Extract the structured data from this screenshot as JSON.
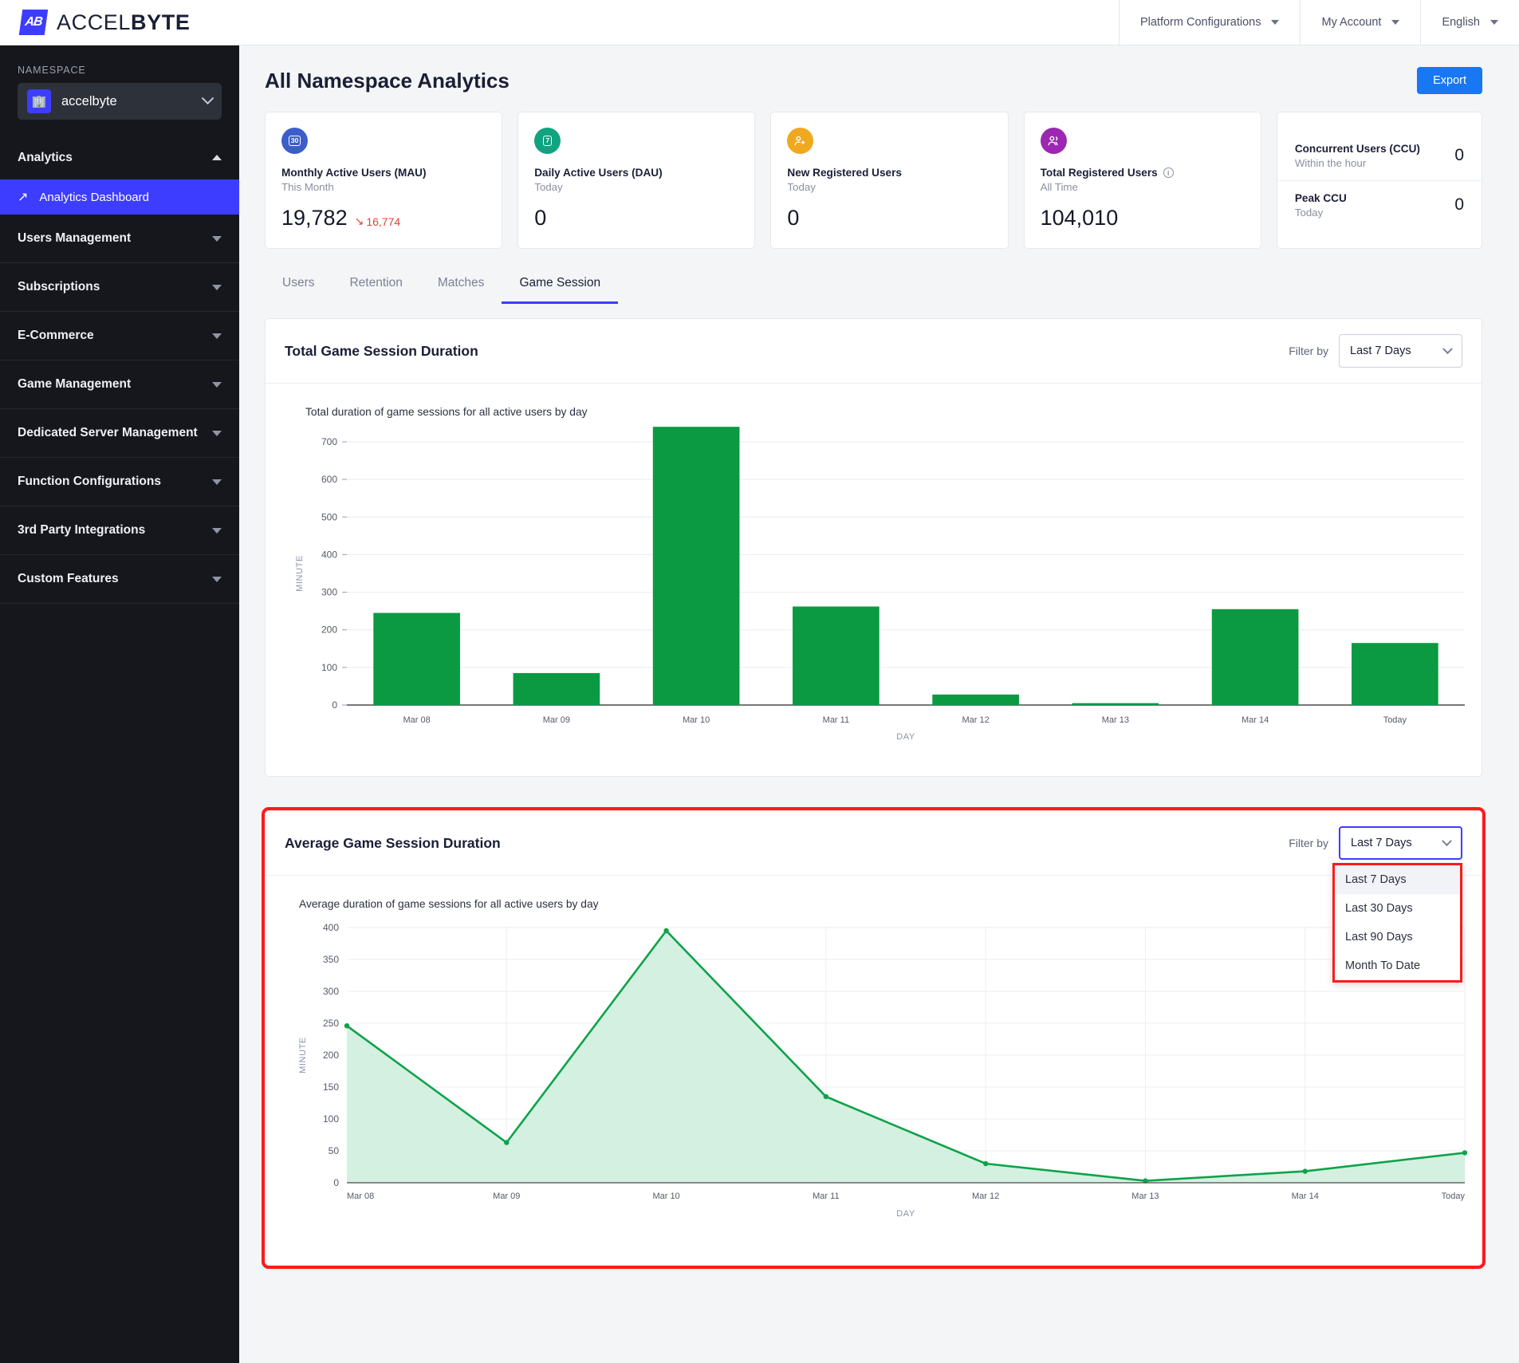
{
  "brand": {
    "name_light": "ACCEL",
    "name_bold": "BYTE",
    "mark_glyph": "AB"
  },
  "topnav": {
    "items": [
      {
        "label": "Platform Configurations",
        "icon": "chevron-down-icon"
      },
      {
        "label": "My Account",
        "icon": "chevron-down-icon"
      },
      {
        "label": "English",
        "icon": "chevron-down-icon"
      }
    ]
  },
  "sidebar": {
    "namespace_label": "NAMESPACE",
    "namespace_value": "accelbyte",
    "namespace_icon": "building-icon",
    "analytics_group": "Analytics",
    "analytics_sub": {
      "label": "Analytics Dashboard",
      "icon": "trending-up-icon"
    },
    "groups": [
      {
        "label": "Users Management"
      },
      {
        "label": "Subscriptions"
      },
      {
        "label": "E-Commerce"
      },
      {
        "label": "Game Management"
      },
      {
        "label": "Dedicated Server Management"
      },
      {
        "label": "Function Configurations"
      },
      {
        "label": "3rd Party Integrations"
      },
      {
        "label": "Custom Features"
      }
    ]
  },
  "header": {
    "title": "All Namespace Analytics",
    "export_label": "Export"
  },
  "kpis": [
    {
      "icon": "calendar-30-icon",
      "icon_glyph": "30",
      "color": "#3b5ec8",
      "name": "Monthly Active Users (MAU)",
      "period": "This Month",
      "value": "19,782",
      "delta": "16,774",
      "delta_direction": "down",
      "delta_color": "#e8403a"
    },
    {
      "icon": "calendar-7-icon",
      "icon_glyph": "7",
      "color": "#10a37f",
      "name": "Daily Active Users (DAU)",
      "period": "Today",
      "value": "0",
      "delta": "",
      "delta_direction": ""
    },
    {
      "icon": "user-plus-icon",
      "icon_glyph": "☺+",
      "color": "#f0a81e",
      "name": "New Registered Users",
      "period": "Today",
      "value": "0",
      "delta": "",
      "delta_direction": ""
    },
    {
      "icon": "users-group-icon",
      "icon_glyph": "☺☺",
      "color": "#9c27b0",
      "name": "Total Registered Users",
      "period": "All Time",
      "value": "104,010",
      "delta": "",
      "delta_direction": "",
      "has_info": true
    }
  ],
  "ccu_card": {
    "rows": [
      {
        "name": "Concurrent Users (CCU)",
        "period": "Within the hour",
        "value": "0"
      },
      {
        "name": "Peak CCU",
        "period": "Today",
        "value": "0"
      }
    ]
  },
  "tabs": [
    {
      "label": "Users",
      "active": false
    },
    {
      "label": "Retention",
      "active": false
    },
    {
      "label": "Matches",
      "active": false
    },
    {
      "label": "Game Session",
      "active": true
    }
  ],
  "total_card": {
    "title": "Total Game Session Duration",
    "filter_label": "Filter by",
    "filter_value": "Last 7 Days"
  },
  "avg_card": {
    "title": "Average Game Session Duration",
    "filter_label": "Filter by",
    "filter_value": "Last 7 Days",
    "dropdown_open": true,
    "dropdown_options": [
      "Last 7 Days",
      "Last 30 Days",
      "Last 90 Days",
      "Month To Date"
    ],
    "dropdown_highlighted": "Last 7 Days",
    "highlight_color": "#ff1a1a"
  },
  "chart_data": [
    {
      "type": "bar",
      "title": "Total duration of game sessions for all active users by day",
      "categories": [
        "Mar 08",
        "Mar 09",
        "Mar 10",
        "Mar 11",
        "Mar 12",
        "Mar 13",
        "Mar 14",
        "Today"
      ],
      "values": [
        245,
        85,
        740,
        262,
        28,
        5,
        255,
        165
      ],
      "xlabel": "DAY",
      "ylabel": "MINUTE",
      "ylim": [
        0,
        700
      ],
      "yticks": [
        0,
        100,
        200,
        300,
        400,
        500,
        600,
        700
      ],
      "grid": true,
      "series_color": "#0b9a41",
      "legend": "none"
    },
    {
      "type": "area",
      "title": "Average duration of game sessions for all active users by day",
      "categories": [
        "Mar 08",
        "Mar 09",
        "Mar 10",
        "Mar 11",
        "Mar 12",
        "Mar 13",
        "Mar 14",
        "Today"
      ],
      "values": [
        246,
        63,
        395,
        135,
        30,
        3,
        18,
        47
      ],
      "xlabel": "DAY",
      "ylabel": "MINUTE",
      "ylim": [
        0,
        400
      ],
      "yticks": [
        0,
        50,
        100,
        150,
        200,
        250,
        300,
        350,
        400
      ],
      "grid": true,
      "series_color": "#0ea34a",
      "fill_color": "#cdeddc",
      "legend": "none"
    }
  ]
}
